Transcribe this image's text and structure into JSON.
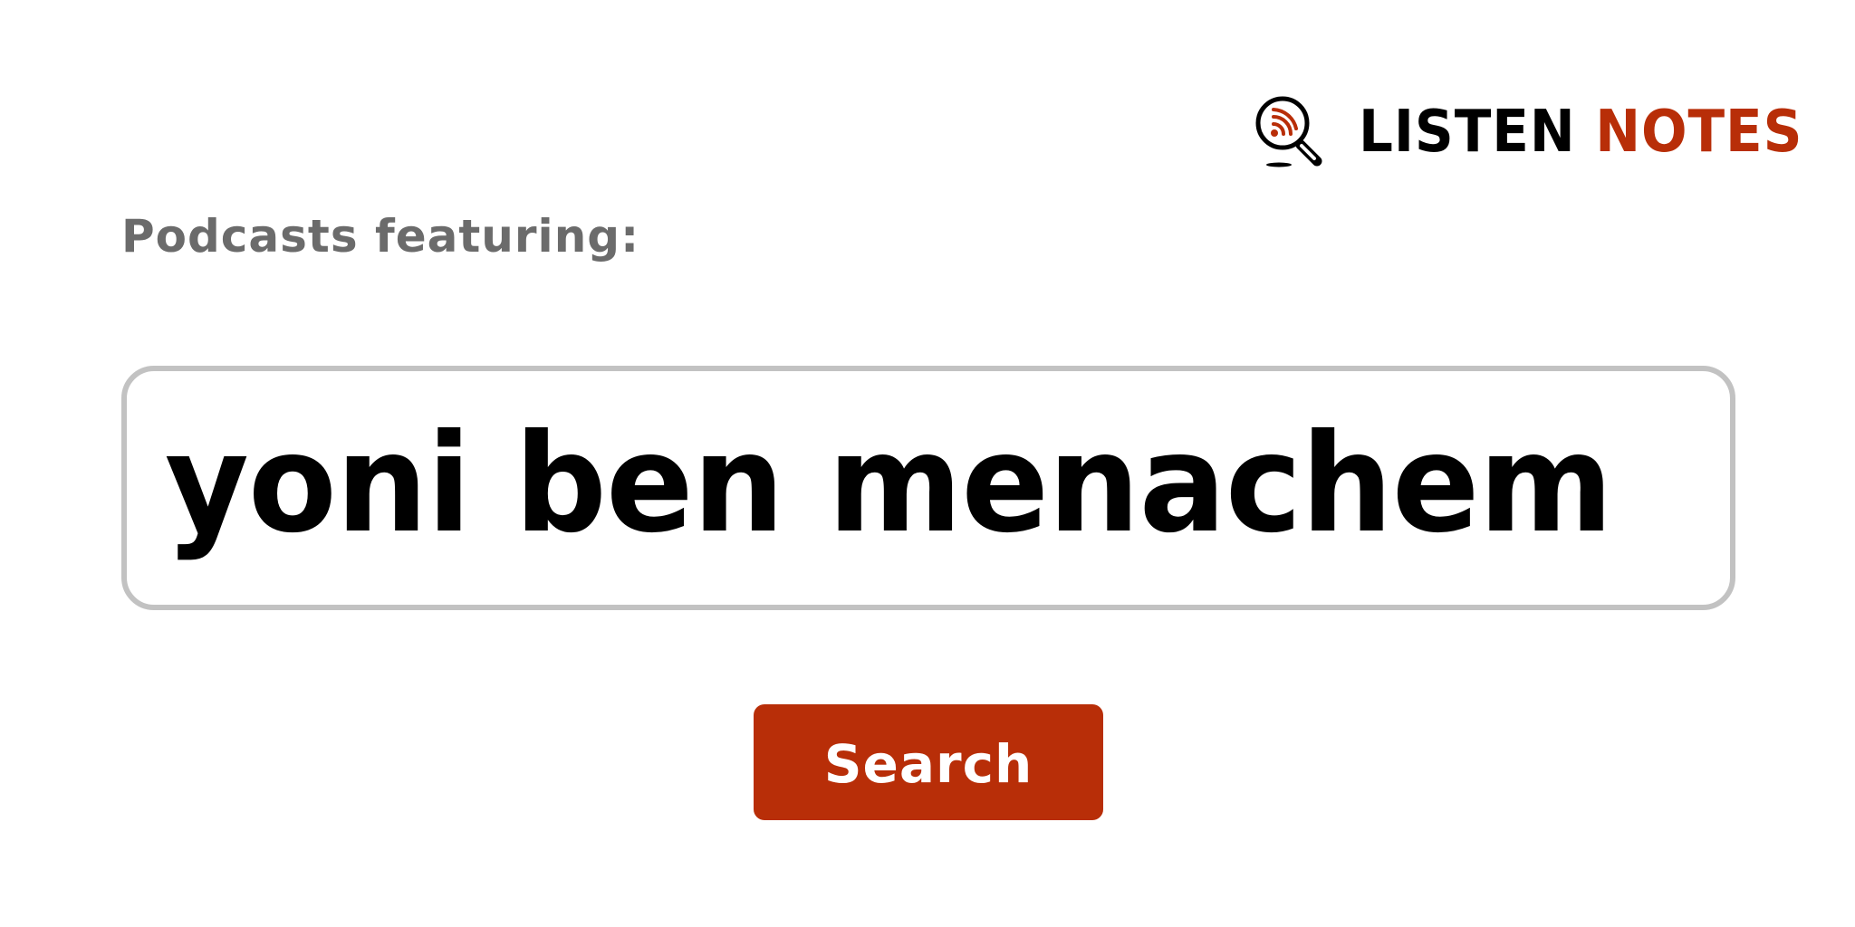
{
  "logo": {
    "icon": "podcast-search-magnifier-icon",
    "word_1": "LISTEN",
    "word_2": "NOTES"
  },
  "heading": {
    "label": "Podcasts featuring:"
  },
  "search": {
    "value": "yoni ben menachem"
  },
  "button": {
    "label": "Search"
  },
  "colors": {
    "brand": "#b82e08",
    "heading_text": "#6b6b6b",
    "input_border": "#c2c2c2",
    "text": "#000000",
    "background": "#ffffff"
  }
}
